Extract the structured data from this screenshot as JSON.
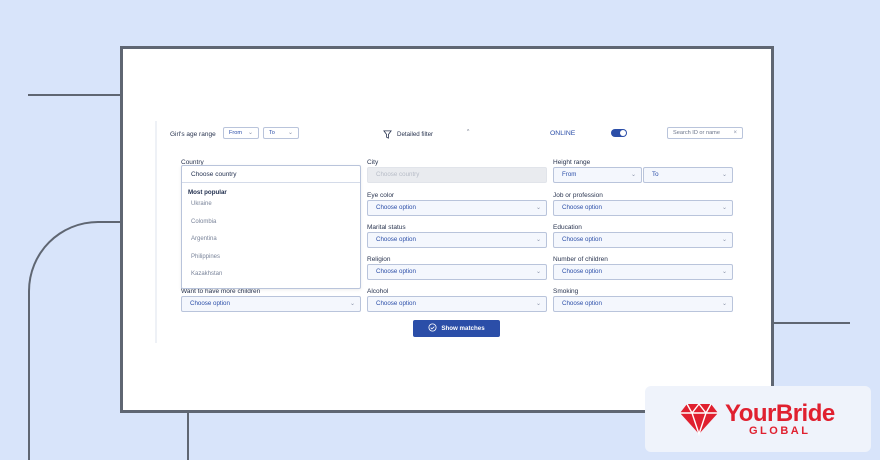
{
  "filter": {
    "age_label": "Girl's age range",
    "age_from": "From",
    "age_to": "To",
    "detailed_filter": "Detailed filter",
    "online_label": "ONLINE",
    "search_placeholder": "Search ID or name"
  },
  "fields": {
    "country_label": "Country",
    "country_value": "Choose country",
    "city_label": "City",
    "city_value": "Choose country",
    "height_label": "Height range",
    "height_from": "From",
    "height_to": "To",
    "eye_label": "Eye color",
    "eye_value": "Choose option",
    "job_label": "Job or profession",
    "job_value": "Choose option",
    "marital_label": "Marital status",
    "marital_value": "Choose option",
    "education_label": "Education",
    "education_value": "Choose option",
    "religion_label": "Religion",
    "religion_value": "Choose option",
    "children_label": "Number of children",
    "children_value": "Choose option",
    "more_children_label": "Want to have more children",
    "more_children_value": "Choose option",
    "alcohol_label": "Alcohol",
    "alcohol_value": "Choose option",
    "smoking_label": "Smoking",
    "smoking_value": "Choose option"
  },
  "dropdown": {
    "header": "Choose country",
    "section": "Most popular",
    "items": [
      "Ukraine",
      "Colombia",
      "Argentina",
      "Philippines",
      "Kazakhstan"
    ]
  },
  "show_button": "Show matches",
  "logo": {
    "brand": "YourBride",
    "sub": "GLOBAL",
    "color": "#e0202f"
  }
}
